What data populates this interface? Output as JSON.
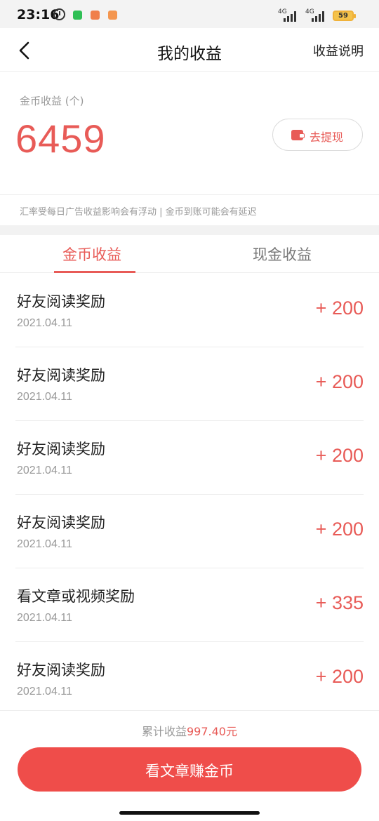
{
  "status_bar": {
    "time": "23:16",
    "network_1": "4G",
    "network_2": "4G",
    "battery": "59"
  },
  "header": {
    "title": "我的收益",
    "right_link": "收益说明"
  },
  "summary": {
    "coin_label": "金币收益 (个)",
    "coin_value": "6459",
    "withdraw_label": "去提现",
    "notice": "汇率受每日广告收益影响会有浮动 | 金币到账可能会有延迟"
  },
  "tabs": [
    {
      "label": "金币收益",
      "active": true
    },
    {
      "label": "现金收益",
      "active": false
    }
  ],
  "records": [
    {
      "title": "好友阅读奖励",
      "date": "2021.04.11",
      "amount": "+ 200"
    },
    {
      "title": "好友阅读奖励",
      "date": "2021.04.11",
      "amount": "+ 200"
    },
    {
      "title": "好友阅读奖励",
      "date": "2021.04.11",
      "amount": "+ 200"
    },
    {
      "title": "好友阅读奖励",
      "date": "2021.04.11",
      "amount": "+ 200"
    },
    {
      "title": "看文章或视频奖励",
      "date": "2021.04.11",
      "amount": "+ 335"
    },
    {
      "title": "好友阅读奖励",
      "date": "2021.04.11",
      "amount": "+ 200"
    }
  ],
  "footer": {
    "total_prefix": "累计收益",
    "total_amount": "997.40元",
    "main_button": "看文章赚金币"
  },
  "colors": {
    "accent": "#e85b57",
    "button": "#ef4d4a"
  }
}
